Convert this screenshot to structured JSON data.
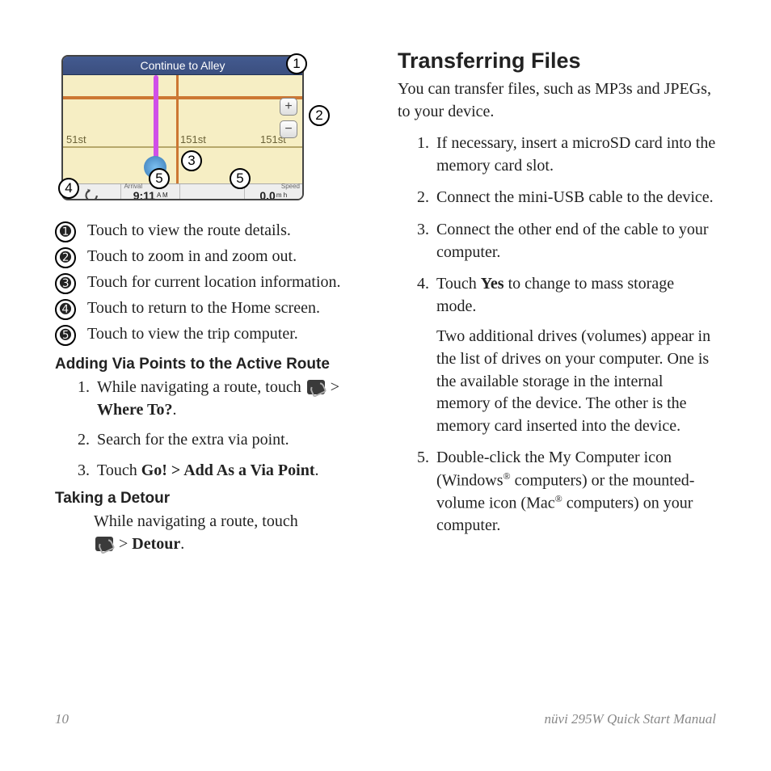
{
  "map": {
    "header": "Continue to Alley",
    "street": "51st",
    "street2": "151st",
    "street3": "151st",
    "arrival_label": "Arrival",
    "arrival_time": "9:11",
    "arrival_ampm": "A M",
    "speed_label": "Speed",
    "speed_val": "0.0",
    "speed_unit": "m h"
  },
  "callouts": [
    "1",
    "2",
    "3",
    "4",
    "5",
    "5"
  ],
  "legend": [
    "Touch to view the route details.",
    "Touch to zoom in and zoom out.",
    "Touch for current location information.",
    "Touch to return to the Home screen.",
    "Touch to view the trip computer."
  ],
  "left": {
    "h1": "Adding Via Points to the Active Route",
    "s1a": "While navigating a route, touch ",
    "s1b": " > ",
    "s1c": "Where To?",
    "s1d": ".",
    "s2": "Search for the extra via point.",
    "s3a": "Touch ",
    "s3b": "Go! > Add As a Via Point",
    "s3c": ".",
    "h2": "Taking a Detour",
    "d1": "While navigating a route, touch ",
    "d2": " > ",
    "d3": "Detour",
    "d4": "."
  },
  "right": {
    "title": "Transferring Files",
    "intro": "You can transfer files, such as MP3s and JPEGs, to your device.",
    "s1": "If necessary, insert a microSD card into the memory card slot.",
    "s2": "Connect the mini-USB cable to the device.",
    "s3": "Connect the other end of the cable to your computer.",
    "s4a": "Touch ",
    "s4b": "Yes",
    "s4c": " to change to mass storage mode.",
    "s4p": "Two additional drives (volumes) appear in the list of drives on your computer. One is the available storage in the internal memory of the device. The other is the memory card inserted into the device.",
    "s5a": "Double-click the My Computer icon (Windows",
    "s5b": " computers) or the mounted-volume icon (Mac",
    "s5c": " computers) on your computer."
  },
  "footer": {
    "page": "10",
    "doc": "nüvi 295W Quick Start Manual"
  }
}
